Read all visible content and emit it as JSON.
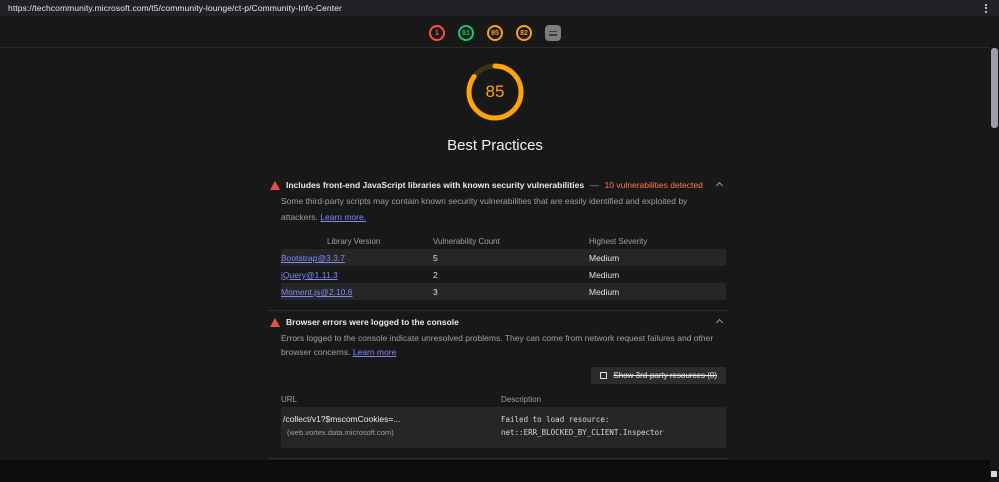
{
  "browser": {
    "url": "https://techcommunity.microsoft.com/t5/community-lounge/ct-p/Community-Info-Center"
  },
  "scores": {
    "items": [
      {
        "value": "1",
        "color": "#ff4e42"
      },
      {
        "value": "91",
        "color": "#0cce6b"
      },
      {
        "value": "85",
        "color": "#ffa400"
      },
      {
        "value": "82",
        "color": "#ffa400"
      }
    ]
  },
  "gauge": {
    "value": "85",
    "percent": 85,
    "color": "#ffa400",
    "label": "Best Practices"
  },
  "colors": {
    "warning": "#e8533a",
    "link": "#8287f5",
    "display_value": "#ff7a55",
    "row_stripe": "#262626"
  },
  "audits": [
    {
      "title": "Includes front-end JavaScript libraries with known security vulnerabilities",
      "separator": "—",
      "display_value": "10 vulnerabilities detected",
      "description": "Some third-party scripts may contain known security vulnerabilities that are easily identified and exploited by attackers.",
      "learn_more": "Learn more.",
      "table": {
        "headers": [
          "Library Version",
          "Vulnerability Count",
          "Highest Severity"
        ],
        "rows": [
          {
            "library": "Bootstrap@3.3.7",
            "count": "5",
            "severity": "Medium"
          },
          {
            "library": "jQuery@1.11.3",
            "count": "2",
            "severity": "Medium"
          },
          {
            "library": "Moment.js@2.10.6",
            "count": "3",
            "severity": "Medium"
          }
        ]
      }
    },
    {
      "title": "Browser errors were logged to the console",
      "description": "Errors logged to the console indicate unresolved problems. They can come from network request failures and other browser concerns.",
      "learn_more": "Learn more",
      "filter_label": "Show 3rd-party resources (0)",
      "table": {
        "headers": [
          "URL",
          "Description"
        ],
        "rows": [
          {
            "url": "/collect/v1?$mscomCookies=...",
            "url_sub": "(web.vortex.data.microsoft.com)",
            "description_line1": "Failed to load resource:",
            "description_line2": "net::ERR_BLOCKED_BY_CLIENT.Inspector"
          }
        ]
      }
    }
  ]
}
